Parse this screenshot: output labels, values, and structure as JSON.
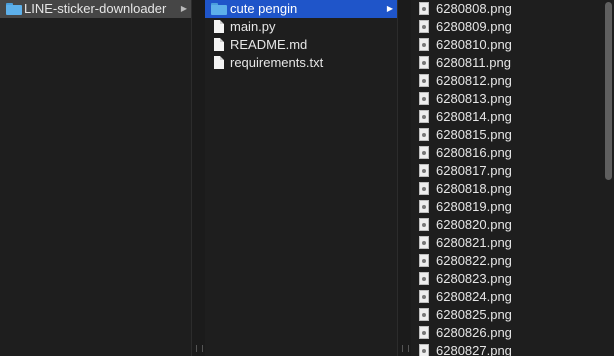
{
  "column1": {
    "items": [
      {
        "label": "LINE-sticker-downloader",
        "icon": "folder-icon"
      }
    ]
  },
  "column2": {
    "items": [
      {
        "label": "cute pengin",
        "icon": "folder-icon"
      },
      {
        "label": "main.py",
        "icon": "document-icon"
      },
      {
        "label": "README.md",
        "icon": "document-icon"
      },
      {
        "label": "requirements.txt",
        "icon": "document-icon"
      }
    ]
  },
  "column3": {
    "files": [
      "6280808.png",
      "6280809.png",
      "6280810.png",
      "6280811.png",
      "6280812.png",
      "6280813.png",
      "6280814.png",
      "6280815.png",
      "6280816.png",
      "6280817.png",
      "6280818.png",
      "6280819.png",
      "6280820.png",
      "6280821.png",
      "6280822.png",
      "6280823.png",
      "6280824.png",
      "6280825.png",
      "6280826.png",
      "6280827.png"
    ]
  },
  "colors": {
    "selection_active": "#1f55c9",
    "selection_inactive": "#464646",
    "folder": "#5db0ea"
  }
}
